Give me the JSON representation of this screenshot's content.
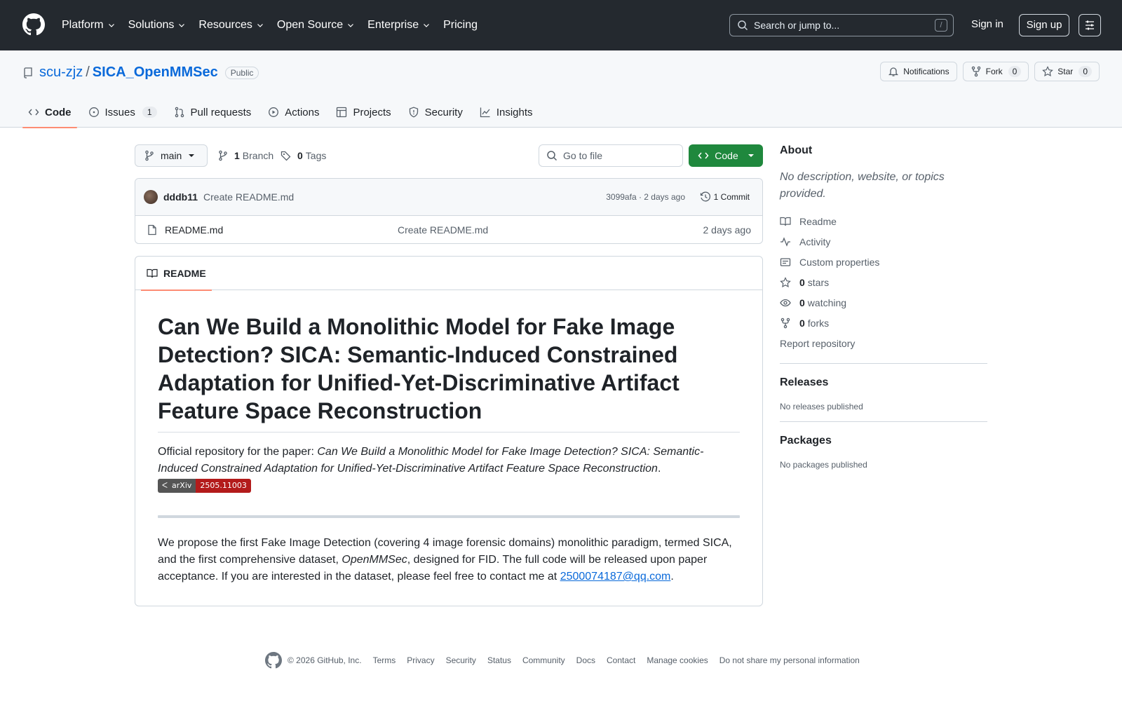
{
  "header": {
    "nav": [
      "Platform",
      "Solutions",
      "Resources",
      "Open Source",
      "Enterprise",
      "Pricing"
    ],
    "search_placeholder": "Search or jump to...",
    "search_shortcut": "/",
    "sign_in": "Sign in",
    "sign_up": "Sign up"
  },
  "repo": {
    "owner": "scu-zjz",
    "separator": "/",
    "name": "SICA_OpenMMSec",
    "visibility": "Public",
    "notifications_label": "Notifications",
    "fork_label": "Fork",
    "fork_count": "0",
    "star_label": "Star",
    "star_count": "0"
  },
  "tabs": [
    {
      "label": "Code",
      "icon": "code-icon"
    },
    {
      "label": "Issues",
      "icon": "issue-icon",
      "count": "1"
    },
    {
      "label": "Pull requests",
      "icon": "pull-request-icon"
    },
    {
      "label": "Actions",
      "icon": "play-icon"
    },
    {
      "label": "Projects",
      "icon": "table-icon"
    },
    {
      "label": "Security",
      "icon": "shield-icon"
    },
    {
      "label": "Insights",
      "icon": "graph-icon"
    }
  ],
  "toolbar": {
    "branch": "main",
    "branch_count": "1",
    "branch_label": "Branch",
    "tag_count": "0",
    "tag_label": "Tags",
    "goto_placeholder": "Go to file",
    "code_button": "Code"
  },
  "latest_commit": {
    "user": "dddb11",
    "message": "Create README.md",
    "meta": "3099afa · 2 days ago",
    "commits_count": "1",
    "commits_label": "Commit"
  },
  "files": [
    {
      "name": "README.md",
      "commit": "Create README.md",
      "time": "2 days ago"
    }
  ],
  "readme": {
    "tab_label": "README",
    "title": "Can We Build a Monolithic Model for Fake Image Detection? SICA: Semantic-Induced Constrained Adaptation for Unified-Yet-Discriminative Artifact Feature Space Reconstruction",
    "intro_prefix": "Official repository for the paper: ",
    "intro_italic": "Can We Build a Monolithic Model for Fake Image Detection? SICA: Semantic-Induced Constrained Adaptation for Unified-Yet-Discriminative Artifact Feature Space Reconstruction",
    "intro_suffix": ".",
    "badge_left": "arXiv",
    "badge_right": "2505.11003",
    "body_1": "We propose the first Fake Image Detection (covering 4 image forensic domains) monolithic paradigm, termed SICA, and the first comprehensive dataset, ",
    "body_italic": "OpenMMSec",
    "body_2": ", designed for FID. The full code will be released upon paper acceptance. If you are interested in the dataset, please feel free to contact me at ",
    "email": "2500074187@qq.com",
    "body_end": "."
  },
  "about": {
    "heading": "About",
    "description": "No description, website, or topics provided.",
    "readme": "Readme",
    "activity": "Activity",
    "custom_properties": "Custom properties",
    "stars_count": "0",
    "stars_label": "stars",
    "watching_count": "0",
    "watching_label": "watching",
    "forks_count": "0",
    "forks_label": "forks",
    "report": "Report repository"
  },
  "releases": {
    "heading": "Releases",
    "empty": "No releases published"
  },
  "packages": {
    "heading": "Packages",
    "empty": "No packages published"
  },
  "footer": {
    "copyright": "© 2026 GitHub, Inc.",
    "links": [
      "Terms",
      "Privacy",
      "Security",
      "Status",
      "Community",
      "Docs",
      "Contact",
      "Manage cookies",
      "Do not share my personal information"
    ]
  },
  "colors": {
    "header_bg": "#24292f",
    "link": "#0969da",
    "primary_button": "#1f883d",
    "active_tab_underline": "#fd8c73",
    "arxiv_badge": "#b31b1b"
  }
}
